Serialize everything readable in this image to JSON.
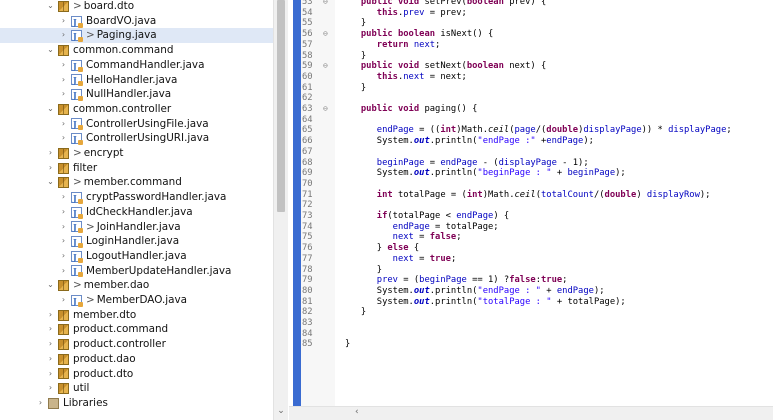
{
  "explorer": {
    "items": [
      {
        "label": "board.dto",
        "depth": 1,
        "toggle": "expanded",
        "kind": "package",
        "dirty": true
      },
      {
        "label": "BoardVO.java",
        "depth": 2,
        "toggle": "collapsed",
        "kind": "java",
        "dirty": false
      },
      {
        "label": "Paging.java",
        "depth": 2,
        "toggle": "collapsed",
        "kind": "java",
        "dirty": true,
        "selected": true
      },
      {
        "label": "common.command",
        "depth": 1,
        "toggle": "expanded",
        "kind": "package",
        "dirty": false
      },
      {
        "label": "CommandHandler.java",
        "depth": 2,
        "toggle": "collapsed",
        "kind": "java",
        "dirty": false
      },
      {
        "label": "HelloHandler.java",
        "depth": 2,
        "toggle": "collapsed",
        "kind": "java",
        "dirty": false
      },
      {
        "label": "NullHandler.java",
        "depth": 2,
        "toggle": "collapsed",
        "kind": "java",
        "dirty": false
      },
      {
        "label": "common.controller",
        "depth": 1,
        "toggle": "expanded",
        "kind": "package",
        "dirty": false
      },
      {
        "label": "ControllerUsingFile.java",
        "depth": 2,
        "toggle": "collapsed",
        "kind": "java",
        "dirty": false
      },
      {
        "label": "ControllerUsingURI.java",
        "depth": 2,
        "toggle": "collapsed",
        "kind": "java",
        "dirty": false
      },
      {
        "label": "encrypt",
        "depth": 1,
        "toggle": "collapsed",
        "kind": "package",
        "dirty": true
      },
      {
        "label": "filter",
        "depth": 1,
        "toggle": "collapsed",
        "kind": "package",
        "dirty": false
      },
      {
        "label": "member.command",
        "depth": 1,
        "toggle": "expanded",
        "kind": "package",
        "dirty": true
      },
      {
        "label": "cryptPasswordHandler.java",
        "depth": 2,
        "toggle": "collapsed",
        "kind": "java",
        "dirty": false
      },
      {
        "label": "IdCheckHandler.java",
        "depth": 2,
        "toggle": "collapsed",
        "kind": "java",
        "dirty": false
      },
      {
        "label": "JoinHandler.java",
        "depth": 2,
        "toggle": "collapsed",
        "kind": "java",
        "dirty": true
      },
      {
        "label": "LoginHandler.java",
        "depth": 2,
        "toggle": "collapsed",
        "kind": "java",
        "dirty": false
      },
      {
        "label": "LogoutHandler.java",
        "depth": 2,
        "toggle": "collapsed",
        "kind": "java",
        "dirty": false
      },
      {
        "label": "MemberUpdateHandler.java",
        "depth": 2,
        "toggle": "collapsed",
        "kind": "java",
        "dirty": false
      },
      {
        "label": "member.dao",
        "depth": 1,
        "toggle": "expanded",
        "kind": "package",
        "dirty": true
      },
      {
        "label": "MemberDAO.java",
        "depth": 2,
        "toggle": "collapsed",
        "kind": "java",
        "dirty": true
      },
      {
        "label": "member.dto",
        "depth": 1,
        "toggle": "collapsed",
        "kind": "package",
        "dirty": false
      },
      {
        "label": "product.command",
        "depth": 1,
        "toggle": "collapsed",
        "kind": "package",
        "dirty": false
      },
      {
        "label": "product.controller",
        "depth": 1,
        "toggle": "collapsed",
        "kind": "package",
        "dirty": false
      },
      {
        "label": "product.dao",
        "depth": 1,
        "toggle": "collapsed",
        "kind": "package",
        "dirty": false
      },
      {
        "label": "product.dto",
        "depth": 1,
        "toggle": "collapsed",
        "kind": "package",
        "dirty": false
      },
      {
        "label": "util",
        "depth": 1,
        "toggle": "collapsed",
        "kind": "package",
        "dirty": false
      },
      {
        "label": "Libraries",
        "depth": 0,
        "toggle": "collapsed",
        "kind": "libraries",
        "dirty": false
      }
    ]
  },
  "editor": {
    "lines": [
      {
        "n": "53",
        "fold": "⊖",
        "html": "   <span class=\"kw\">public void</span> setPrev(<span class=\"kw\">boolean</span> prev) {"
      },
      {
        "n": "54",
        "fold": "",
        "html": "      <span class=\"kw\">this</span>.<span class=\"fld\">prev</span> = prev;"
      },
      {
        "n": "55",
        "fold": "",
        "html": "   }"
      },
      {
        "n": "56",
        "fold": "⊖",
        "html": "   <span class=\"kw\">public boolean</span> isNext() {"
      },
      {
        "n": "57",
        "fold": "",
        "html": "      <span class=\"kw\">return</span> <span class=\"fld\">next</span>;"
      },
      {
        "n": "58",
        "fold": "",
        "html": "   }"
      },
      {
        "n": "59",
        "fold": "⊖",
        "html": "   <span class=\"kw\">public void</span> setNext(<span class=\"kw\">boolean</span> next) {"
      },
      {
        "n": "60",
        "fold": "",
        "html": "      <span class=\"kw\">this</span>.<span class=\"fld\">next</span> = next;"
      },
      {
        "n": "61",
        "fold": "",
        "html": "   }"
      },
      {
        "n": "62",
        "fold": "",
        "html": ""
      },
      {
        "n": "63",
        "fold": "⊖",
        "html": "   <span class=\"kw\">public void</span> paging() {"
      },
      {
        "n": "64",
        "fold": "",
        "html": ""
      },
      {
        "n": "65",
        "fold": "",
        "html": "      <span class=\"fld\">endPage</span> = ((<span class=\"kw\">int</span>)Math.<span class=\"st\">ceil</span>(<span class=\"fld\">page</span>/(<span class=\"kw\">double</span>)<span class=\"fld\">displayPage</span>)) * <span class=\"fld\">displayPage</span>;"
      },
      {
        "n": "66",
        "fold": "",
        "html": "      System.<span class=\"stf\">out</span>.println(<span class=\"str\">\"endPage :\"</span> +<span class=\"fld\">endPage</span>);"
      },
      {
        "n": "67",
        "fold": "",
        "html": ""
      },
      {
        "n": "68",
        "fold": "",
        "html": "      <span class=\"fld\">beginPage</span> = <span class=\"fld\">endPage</span> - (<span class=\"fld\">displayPage</span> - 1);"
      },
      {
        "n": "69",
        "fold": "",
        "html": "      System.<span class=\"stf\">out</span>.println(<span class=\"str\">\"beginPage : \"</span> + <span class=\"fld\">beginPage</span>);"
      },
      {
        "n": "70",
        "fold": "",
        "html": ""
      },
      {
        "n": "71",
        "fold": "",
        "html": "      <span class=\"kw\">int</span> totalPage = (<span class=\"kw\">int</span>)Math.<span class=\"st\">ceil</span>(<span class=\"fld\">totalCount</span>/(<span class=\"kw\">double</span>) <span class=\"fld\">displayRow</span>);"
      },
      {
        "n": "72",
        "fold": "",
        "html": ""
      },
      {
        "n": "73",
        "fold": "",
        "html": "      <span class=\"kw\">if</span>(totalPage &lt; <span class=\"fld\">endPage</span>) {"
      },
      {
        "n": "74",
        "fold": "",
        "html": "         <span class=\"fld\">endPage</span> = totalPage;"
      },
      {
        "n": "75",
        "fold": "",
        "html": "         <span class=\"fld\">next</span> = <span class=\"kw\">false</span>;"
      },
      {
        "n": "76",
        "fold": "",
        "html": "      } <span class=\"kw\">else</span> {"
      },
      {
        "n": "77",
        "fold": "",
        "html": "         <span class=\"fld\">next</span> = <span class=\"kw\">true</span>;"
      },
      {
        "n": "78",
        "fold": "",
        "html": "      }"
      },
      {
        "n": "79",
        "fold": "",
        "html": "      <span class=\"fld\">prev</span> = (<span class=\"fld\">beginPage</span> == 1) ?<span class=\"kw\">false</span>:<span class=\"kw\">true</span>;"
      },
      {
        "n": "80",
        "fold": "",
        "html": "      System.<span class=\"stf\">out</span>.println(<span class=\"str\">\"endPage : \"</span> + <span class=\"fld\">endPage</span>);"
      },
      {
        "n": "81",
        "fold": "",
        "html": "      System.<span class=\"stf\">out</span>.println(<span class=\"str\">\"totalPage : \"</span> + totalPage);"
      },
      {
        "n": "82",
        "fold": "",
        "html": "   }"
      },
      {
        "n": "83",
        "fold": "",
        "html": ""
      },
      {
        "n": "84",
        "fold": "",
        "html": ""
      },
      {
        "n": "85",
        "fold": "",
        "html": "}"
      }
    ]
  },
  "colors": {
    "keyword": "#7f0055",
    "field": "#0000c0",
    "string": "#2a00ff",
    "gutter_marker": "#3a6bd1"
  }
}
